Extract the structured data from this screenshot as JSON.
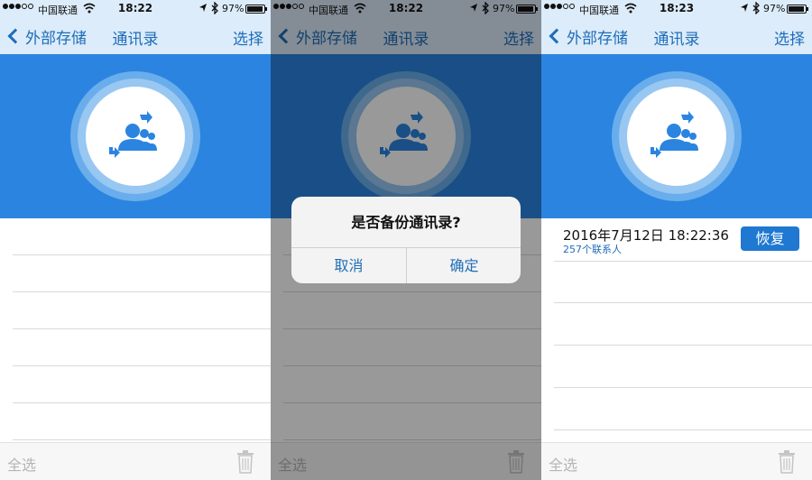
{
  "screens": [
    {
      "status": {
        "carrier": "中国联通",
        "time": "18:22",
        "battery": "97%"
      },
      "nav": {
        "back": "外部存储",
        "title": "通讯录",
        "right": "选择"
      },
      "toolbar": {
        "select_all": "全选"
      }
    },
    {
      "status": {
        "carrier": "中国联通",
        "time": "18:22",
        "battery": "97%"
      },
      "nav": {
        "back": "外部存储",
        "title": "通讯录",
        "right": "选择"
      },
      "alert": {
        "title": "是否备份通讯录?",
        "cancel": "取消",
        "ok": "确定"
      },
      "toolbar": {
        "select_all": "全选"
      }
    },
    {
      "status": {
        "carrier": "中国联通",
        "time": "18:23",
        "battery": "97%"
      },
      "nav": {
        "back": "外部存储",
        "title": "通讯录",
        "right": "选择"
      },
      "backup": {
        "date": "2016年7月12日 18:22:36",
        "count": "257个联系人",
        "restore": "恢复"
      },
      "toolbar": {
        "select_all": "全选"
      }
    }
  ],
  "colors": {
    "accent": "#2b84e0",
    "nav_bg": "#dcecfa",
    "link": "#1f6db8"
  },
  "icons": [
    "back-chevron-icon",
    "wifi-icon",
    "location-icon",
    "bluetooth-icon",
    "battery-icon",
    "contacts-sync-icon",
    "trash-icon"
  ]
}
